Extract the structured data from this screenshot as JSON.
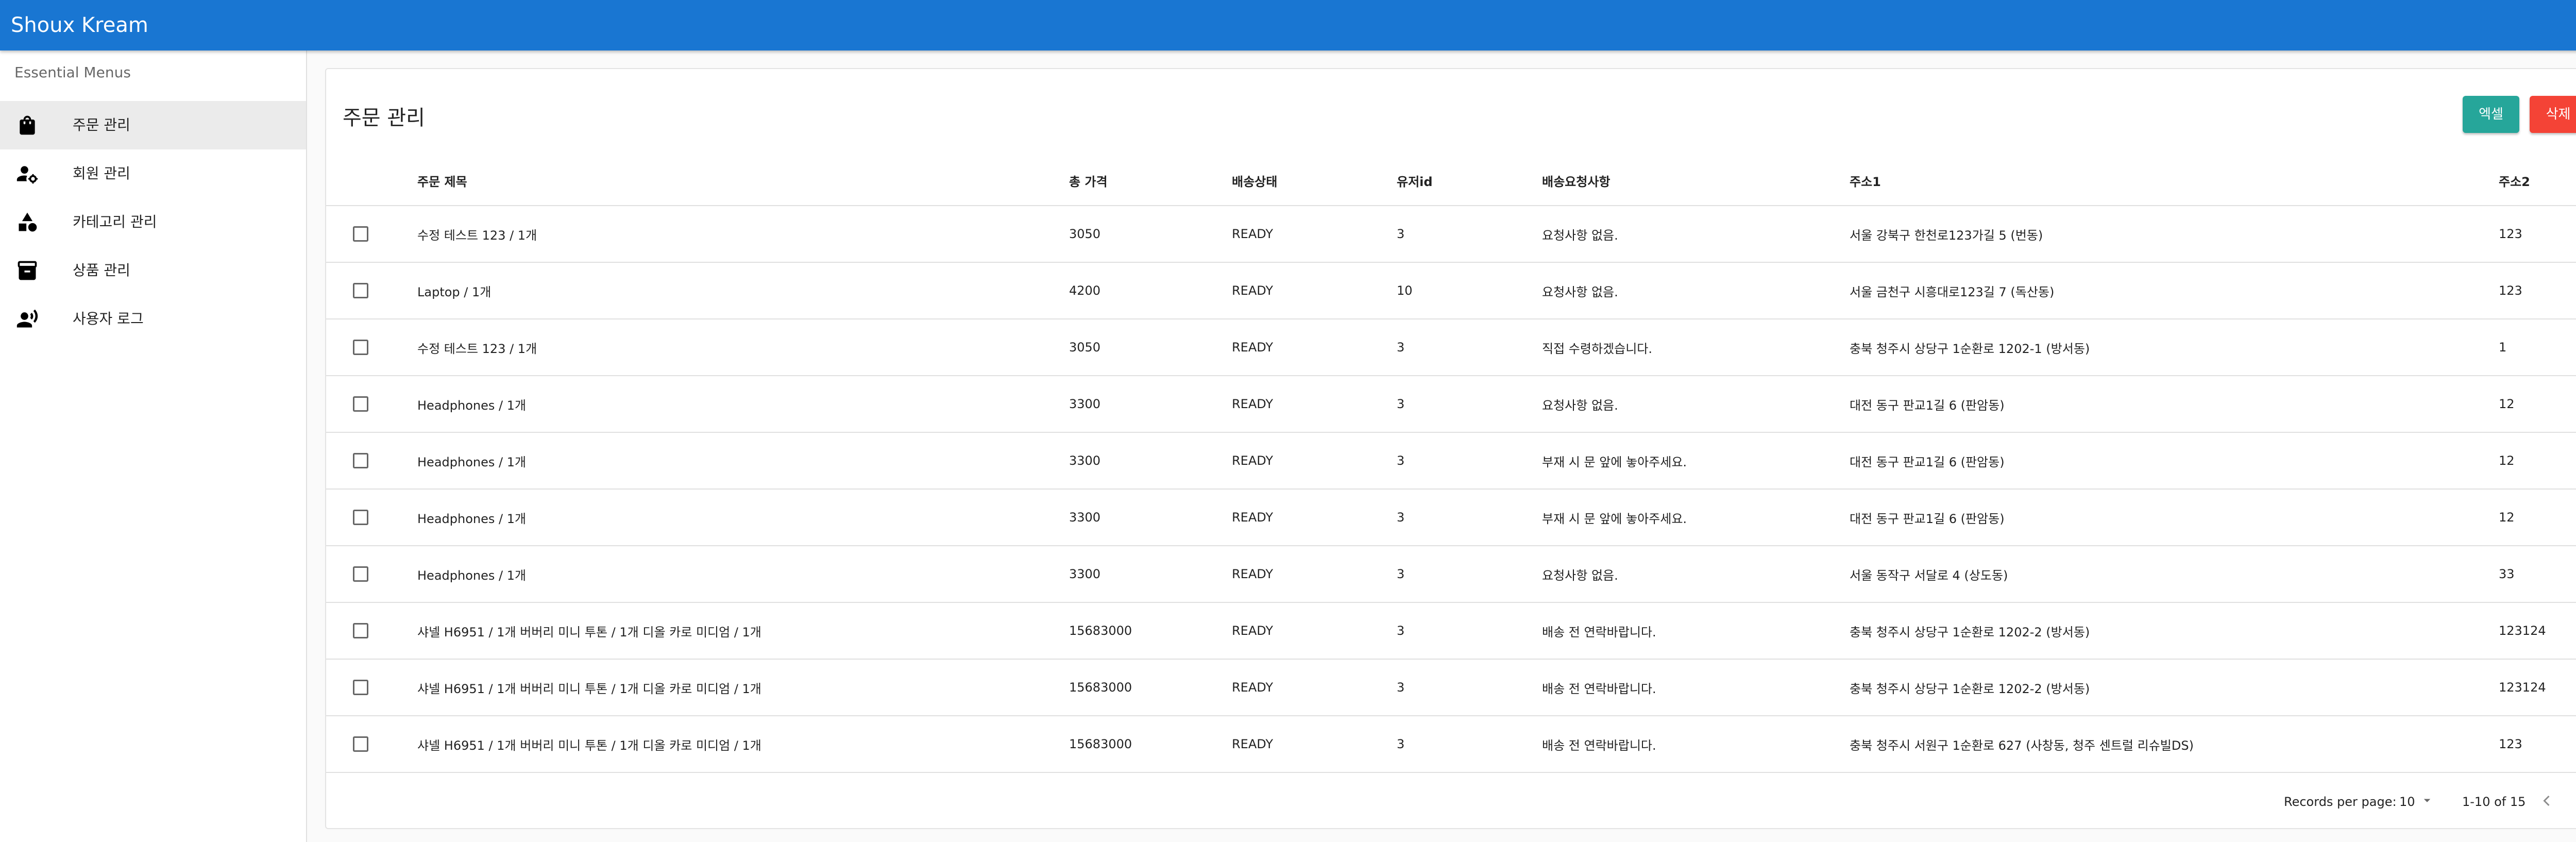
{
  "app": {
    "title": "Shoux Kream"
  },
  "sidebar": {
    "subheader": "Essential Menus",
    "items": [
      {
        "label": "주문 관리",
        "icon": "shopping-bag-icon",
        "active": true
      },
      {
        "label": "회원 관리",
        "icon": "manage-accounts-icon",
        "active": false
      },
      {
        "label": "카테고리 관리",
        "icon": "category-shapes-icon",
        "active": false
      },
      {
        "label": "상품 관리",
        "icon": "inventory-box-icon",
        "active": false
      },
      {
        "label": "사용자 로그",
        "icon": "record-voice-icon",
        "active": false
      }
    ]
  },
  "main": {
    "title": "주문 관리",
    "excel_button": "엑셀",
    "delete_button": "삭제"
  },
  "table": {
    "columns": [
      "주문 제목",
      "총 가격",
      "배송상태",
      "유저id",
      "배송요청사항",
      "주소1",
      "주소2"
    ],
    "rows": [
      [
        "수정 테스트 123 / 1개",
        "3050",
        "READY",
        "3",
        "요청사항 없음.",
        "서울 강북구 한천로123가길 5 (번동)",
        "123"
      ],
      [
        "Laptop / 1개",
        "4200",
        "READY",
        "10",
        "요청사항 없음.",
        "서울 금천구 시흥대로123길 7 (독산동)",
        "123"
      ],
      [
        "수정 테스트 123 / 1개",
        "3050",
        "READY",
        "3",
        "직접 수령하겠습니다.",
        "충북 청주시 상당구 1순환로 1202-1 (방서동)",
        "1"
      ],
      [
        "Headphones / 1개",
        "3300",
        "READY",
        "3",
        "요청사항 없음.",
        "대전 동구 판교1길 6 (판암동)",
        "12"
      ],
      [
        "Headphones / 1개",
        "3300",
        "READY",
        "3",
        "부재 시 문 앞에 놓아주세요.",
        "대전 동구 판교1길 6 (판암동)",
        "12"
      ],
      [
        "Headphones / 1개",
        "3300",
        "READY",
        "3",
        "부재 시 문 앞에 놓아주세요.",
        "대전 동구 판교1길 6 (판암동)",
        "12"
      ],
      [
        "Headphones / 1개",
        "3300",
        "READY",
        "3",
        "요청사항 없음.",
        "서울 동작구 서달로 4 (상도동)",
        "33"
      ],
      [
        "샤넬 H6951 / 1개 버버리 미니 투톤 / 1개 디올 카로 미디엄 / 1개",
        "15683000",
        "READY",
        "3",
        "배송 전 연락바랍니다.",
        "충북 청주시 상당구 1순환로 1202-2 (방서동)",
        "123124"
      ],
      [
        "샤넬 H6951 / 1개 버버리 미니 투톤 / 1개 디올 카로 미디엄 / 1개",
        "15683000",
        "READY",
        "3",
        "배송 전 연락바랍니다.",
        "충북 청주시 상당구 1순환로 1202-2 (방서동)",
        "123124"
      ],
      [
        "샤넬 H6951 / 1개 버버리 미니 투톤 / 1개 디올 카로 미디엄 / 1개",
        "15683000",
        "READY",
        "3",
        "배송 전 연락바랍니다.",
        "충북 청주시 서원구 1순환로 627 (사창동, 청주 센트럴 리슈빌DS)",
        "123"
      ]
    ]
  },
  "pagination": {
    "rows_per_page_label": "Records per page:",
    "rows_per_page": "10",
    "range": "1-10 of 15"
  }
}
